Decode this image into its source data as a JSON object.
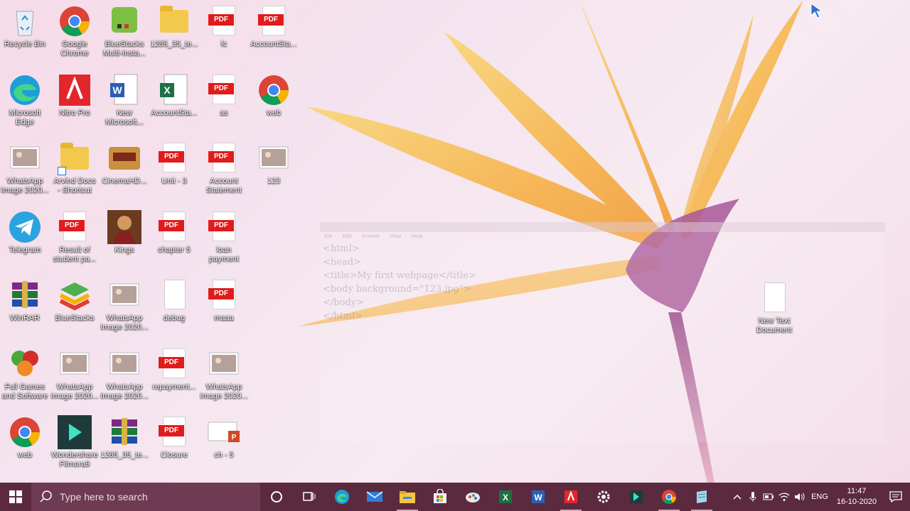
{
  "desktop": {
    "icons": [
      {
        "label": "Recycle Bin",
        "icon": "recycle-bin-icon"
      },
      {
        "label": "Google\nChrome",
        "icon": "chrome-icon"
      },
      {
        "label": "BlueStacks\nMulti-Insta...",
        "icon": "bluestacks-multi-icon"
      },
      {
        "label": "1285_35_te...",
        "icon": "folder-zip-icon"
      },
      {
        "label": "fc",
        "icon": "pdf-icon"
      },
      {
        "label": "AccountSta...",
        "icon": "pdf-icon"
      },
      {
        "label": "Microsoft\nEdge",
        "icon": "edge-icon"
      },
      {
        "label": "Nitro Pro",
        "icon": "nitro-icon"
      },
      {
        "label": "New\nMicrosoft...",
        "icon": "word-doc-icon"
      },
      {
        "label": "AccountSta...",
        "icon": "excel-doc-icon"
      },
      {
        "label": "as",
        "icon": "pdf-icon"
      },
      {
        "label": "web",
        "icon": "chrome-icon"
      },
      {
        "label": "WhatsApp\nImage 2020...",
        "icon": "image-icon"
      },
      {
        "label": "Arvind Docs\n- Shortcut",
        "icon": "folder-icon"
      },
      {
        "label": "CinemaHD...",
        "icon": "cinemahd-icon"
      },
      {
        "label": "Unit - 3",
        "icon": "pdf-icon"
      },
      {
        "label": "Account\nStatement",
        "icon": "pdf-icon"
      },
      {
        "label": "123",
        "icon": "image-icon"
      },
      {
        "label": "Telegram",
        "icon": "telegram-icon"
      },
      {
        "label": "Result of\nstudent pa...",
        "icon": "pdf-icon"
      },
      {
        "label": "Kings",
        "icon": "game-icon"
      },
      {
        "label": "chapter 5",
        "icon": "pdf-icon"
      },
      {
        "label": "loan\npayment",
        "icon": "pdf-icon"
      },
      {
        "label": "WinRAR",
        "icon": "winrar-icon"
      },
      {
        "label": "BlueStacks",
        "icon": "bluestacks-icon"
      },
      {
        "label": "WhatsApp\nImage 2020...",
        "icon": "image-icon"
      },
      {
        "label": "debug",
        "icon": "text-file-icon"
      },
      {
        "label": "maaa",
        "icon": "pdf-icon"
      },
      {
        "label": "Full Games\nand Software",
        "icon": "cubes-icon"
      },
      {
        "label": "WhatsApp\nImage 2020...",
        "icon": "image-icon"
      },
      {
        "label": "WhatsApp\nImage 2020...",
        "icon": "image-icon"
      },
      {
        "label": "repayment...",
        "icon": "pdf-icon"
      },
      {
        "label": "WhatsApp\nImage 2020...",
        "icon": "image-icon"
      },
      {
        "label": "web",
        "icon": "chrome-icon"
      },
      {
        "label": "Wondershare\nFilmora9",
        "icon": "filmora-icon"
      },
      {
        "label": "1285_35_te...",
        "icon": "winrar-icon"
      },
      {
        "label": "Closure",
        "icon": "pdf-icon"
      },
      {
        "label": "ch - 5",
        "icon": "powerpoint-icon"
      },
      {
        "label": "New Text\nDocument",
        "icon": "text-file-icon"
      }
    ]
  },
  "ghost_notepad": {
    "menu": [
      "File",
      "Edit",
      "Format",
      "View",
      "Help"
    ],
    "lines": [
      "<html>",
      "<head>",
      "<title>My first webpage</title>",
      "<body background=\"123.jpg\">",
      "</body>",
      "</html>"
    ]
  },
  "taskbar": {
    "search_placeholder": "Type here to search",
    "pinned": [
      "cortana-icon",
      "task-view-icon",
      "edge-icon",
      "mail-icon",
      "file-explorer-icon",
      "store-icon",
      "paint-icon",
      "excel-icon",
      "word-icon",
      "nitro-icon",
      "settings-icon",
      "filmora-icon",
      "chrome-icon",
      "notepad-icon"
    ],
    "tray": {
      "language": "ENG",
      "time": "11:47",
      "date": "16-10-2020"
    }
  },
  "colors": {
    "taskbar": "#5b2a3e",
    "search": "#6e3b52",
    "pdf_red": "#e11b1b"
  }
}
